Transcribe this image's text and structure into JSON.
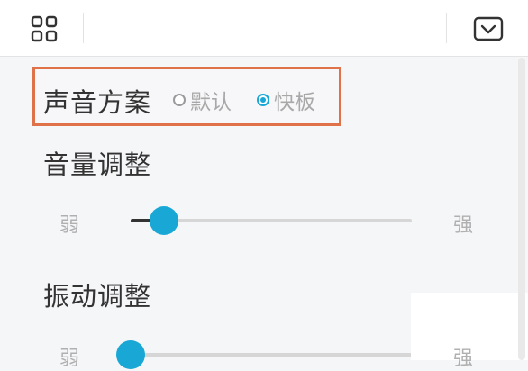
{
  "header": {
    "menu_icon": "grid-icon",
    "collapse_icon": "chevron-down-icon"
  },
  "sound_scheme": {
    "label": "声音方案",
    "options": [
      {
        "label": "默认",
        "selected": false
      },
      {
        "label": "快板",
        "selected": true
      }
    ]
  },
  "volume": {
    "label": "音量调整",
    "min_label": "弱",
    "max_label": "强",
    "level": 0.12
  },
  "vibration": {
    "label": "振动调整",
    "min_label": "弱",
    "max_label": "强",
    "level": 0.0
  },
  "colors": {
    "accent": "#19a8d6",
    "highlight_border": "#e0724a",
    "track": "#d6d6d6",
    "fill_dark": "#333333"
  }
}
